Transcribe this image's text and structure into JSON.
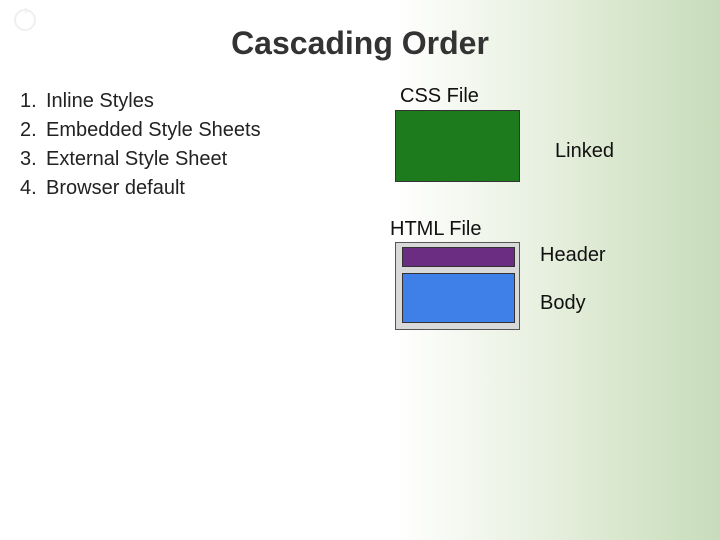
{
  "title": "Cascading Order",
  "list": {
    "items": [
      {
        "num": "1.",
        "text": "Inline Styles"
      },
      {
        "num": "2.",
        "text": "Embedded Style Sheets"
      },
      {
        "num": "3.",
        "text": "External Style Sheet"
      },
      {
        "num": "4.",
        "text": "Browser default"
      }
    ]
  },
  "diagram": {
    "css_file_label": "CSS File",
    "linked_label": "Linked",
    "html_file_label": "HTML File",
    "header_label": "Header",
    "body_label": "Body"
  },
  "colors": {
    "css_box": "#1d7a1d",
    "html_box_bg": "#d9d9d9",
    "header_box": "#6b2d82",
    "body_box": "#3f7fe8"
  }
}
